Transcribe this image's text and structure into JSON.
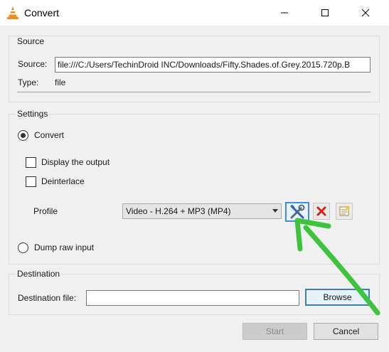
{
  "window": {
    "title": "Convert",
    "icon": "vlc-cone-icon",
    "controls": [
      "minimize-icon",
      "maximize-icon",
      "close-icon"
    ]
  },
  "source_group": {
    "title": "Source",
    "source_label": "Source:",
    "source_value": "file:///C:/Users/TechinDroid INC/Downloads/Fifty.Shades.of.Grey.2015.720p.B",
    "type_label": "Type:",
    "type_value": "file"
  },
  "settings_group": {
    "title": "Settings",
    "convert_label": "Convert",
    "convert_selected": true,
    "display_output_label": "Display the output",
    "display_output_checked": false,
    "deinterlace_label": "Deinterlace",
    "deinterlace_checked": false,
    "profile_label": "Profile",
    "profile_value": "Video - H.264 + MP3 (MP4)",
    "profile_tools": [
      "edit-profile-icon",
      "delete-profile-icon",
      "new-profile-icon"
    ],
    "dump_raw_label": "Dump raw input",
    "dump_raw_selected": false
  },
  "destination_group": {
    "title": "Destination",
    "dest_label": "Destination file:",
    "dest_value": "",
    "browse_label": "Browse"
  },
  "footer": {
    "start_label": "Start",
    "start_enabled": false,
    "cancel_label": "Cancel"
  },
  "annotation": {
    "color": "#3cc43c"
  }
}
